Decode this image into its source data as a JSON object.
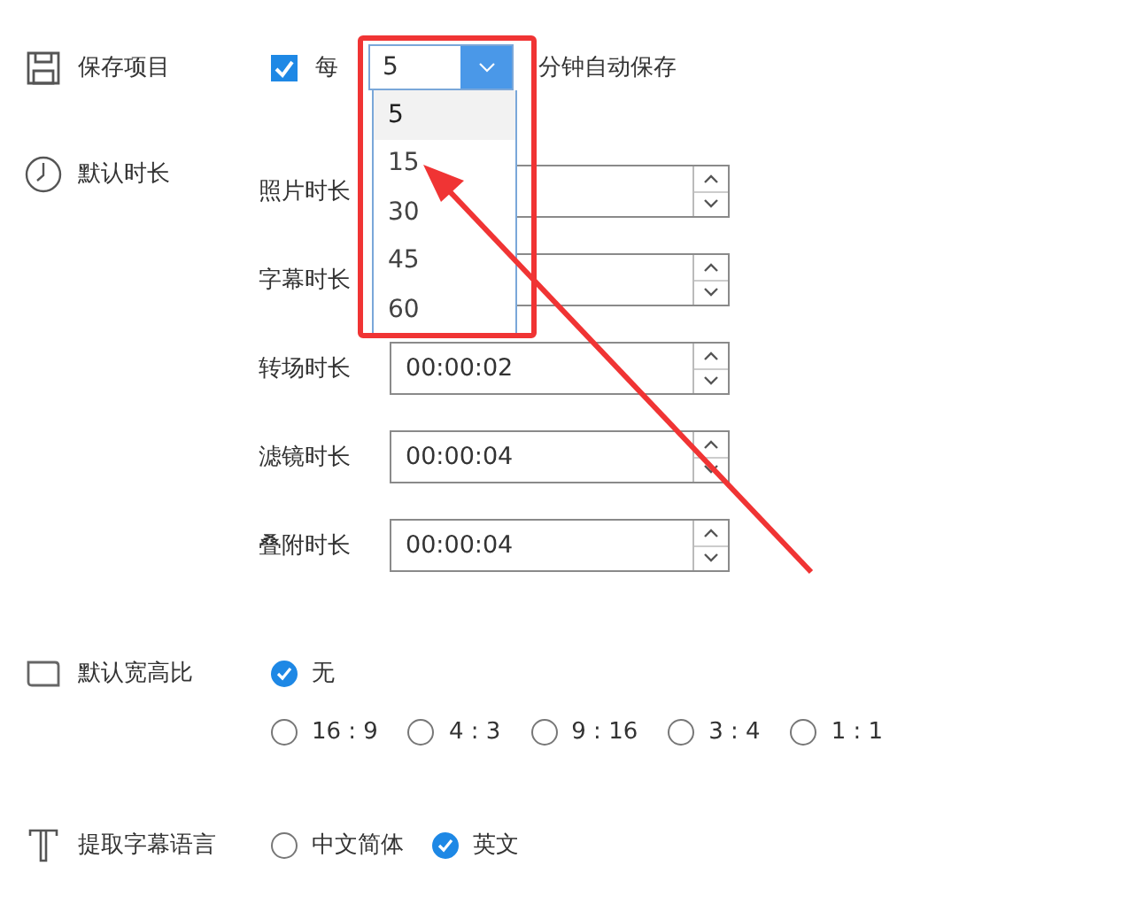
{
  "autosave": {
    "label": "保存项目",
    "checked": true,
    "prefix": "每",
    "value": "5",
    "suffix": "分钟自动保存",
    "options": [
      {
        "label": "5",
        "selected": true
      },
      {
        "label": "15",
        "selected": false
      },
      {
        "label": "30",
        "selected": false
      },
      {
        "label": "45",
        "selected": false
      },
      {
        "label": "60",
        "selected": false
      }
    ]
  },
  "durations": {
    "label": "默认时长",
    "items": [
      {
        "label": "照片时长"
      },
      {
        "label": "字幕时长"
      },
      {
        "label": "转场时长",
        "value": "00:00:02"
      },
      {
        "label": "滤镜时长",
        "value": "00:00:04"
      },
      {
        "label": "叠附时长",
        "value": "00:00:04"
      }
    ]
  },
  "aspect": {
    "label": "默认宽高比",
    "options": [
      {
        "label": "无",
        "selected": true
      },
      {
        "label": "16 : 9",
        "selected": false
      },
      {
        "label": "4 : 3",
        "selected": false
      },
      {
        "label": "9 : 16",
        "selected": false
      },
      {
        "label": "3 : 4",
        "selected": false
      },
      {
        "label": "1 : 1",
        "selected": false
      }
    ]
  },
  "subtitle_language": {
    "label": "提取字幕语言",
    "options": [
      {
        "label": "中文简体",
        "selected": false
      },
      {
        "label": "英文",
        "selected": true
      }
    ]
  }
}
